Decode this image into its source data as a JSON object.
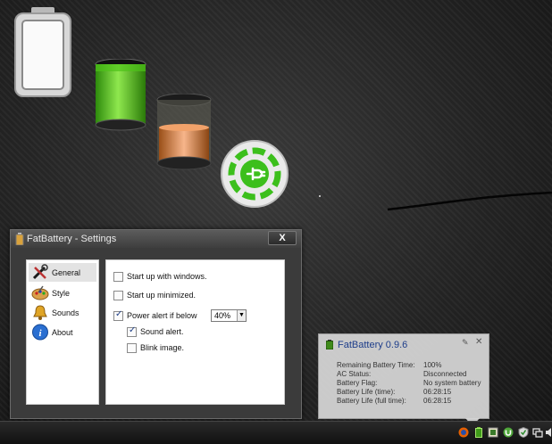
{
  "settings_window": {
    "title": "FatBattery - Settings",
    "close_label": "X",
    "nav": [
      {
        "label": "General",
        "icon": "tools-icon",
        "selected": true
      },
      {
        "label": "Style",
        "icon": "palette-icon",
        "selected": false
      },
      {
        "label": "Sounds",
        "icon": "bell-icon",
        "selected": false
      },
      {
        "label": "About",
        "icon": "info-icon",
        "selected": false
      }
    ],
    "options": {
      "startup_windows": {
        "label": "Start up with windows.",
        "checked": false
      },
      "startup_minimized": {
        "label": "Start up minimized.",
        "checked": false
      },
      "power_alert": {
        "label": "Power alert if below",
        "checked": true
      },
      "power_alert_value": "40%",
      "sound_alert": {
        "label": "Sound alert.",
        "checked": true
      },
      "blink_image": {
        "label": "Blink image.",
        "checked": false
      }
    }
  },
  "balloon": {
    "title": "FatBattery 0.9.6",
    "rows": [
      {
        "key": "Remaining Battery Time:",
        "value": "100%"
      },
      {
        "key": "AC Status:",
        "value": "Disconnected"
      },
      {
        "key": "Battery Flag:",
        "value": "No system battery"
      },
      {
        "key": "Battery Life (time):",
        "value": "06:28:15"
      },
      {
        "key": "Battery Life (full time):",
        "value": "06:28:15"
      }
    ]
  },
  "taskbar": {
    "tray_icons": [
      "firefox-icon",
      "battery-icon",
      "gadget-icon",
      "utorrent-icon",
      "shield-icon",
      "network-icon",
      "speaker-icon"
    ]
  },
  "colors": {
    "battery_green": "#4fc21a",
    "battery_orange": "#e28a3a",
    "title_blue": "#1d3d8a"
  }
}
